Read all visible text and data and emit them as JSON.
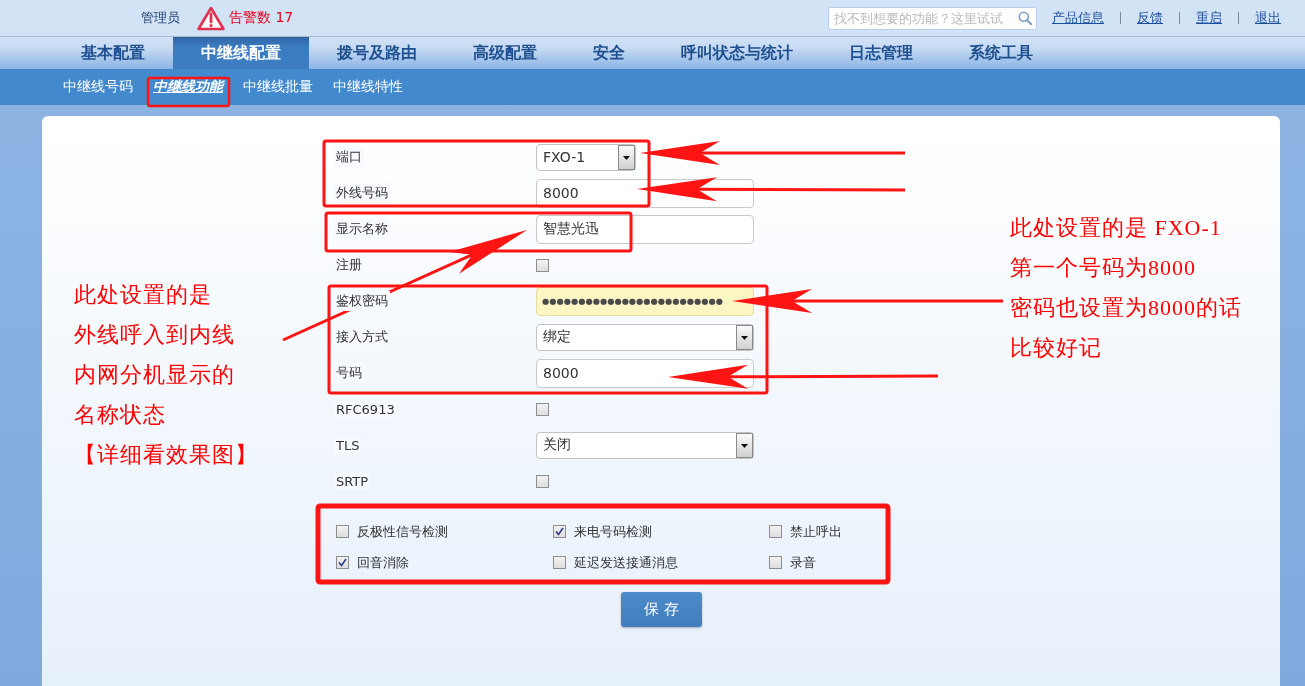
{
  "top_bar": {
    "user": "管理员",
    "alarm": "告警数 17",
    "search": {
      "placeholder": "找不到想要的功能？这里试试"
    },
    "links": [
      "产品信息",
      "反馈",
      "重启",
      "退出"
    ]
  },
  "main_nav": [
    {
      "label": "基本配置",
      "selected": false
    },
    {
      "label": "中继线配置",
      "selected": true
    },
    {
      "label": "拨号及路由",
      "selected": false
    },
    {
      "label": "高级配置",
      "selected": false
    },
    {
      "label": "安全",
      "selected": false
    },
    {
      "label": "呼叫状态与统计",
      "selected": false
    },
    {
      "label": "日志管理",
      "selected": false
    },
    {
      "label": "系统工具",
      "selected": false
    }
  ],
  "sub_nav": [
    {
      "label": "中继线号码",
      "selected": false
    },
    {
      "label": "中继线功能",
      "selected": true
    },
    {
      "label": "中继线批量",
      "selected": false
    },
    {
      "label": "中继线特性",
      "selected": false
    }
  ],
  "form": {
    "fields": [
      {
        "label": "端口",
        "kind": "select",
        "value": "FXO-1"
      },
      {
        "label": "外线号码",
        "kind": "text",
        "value": "8000"
      },
      {
        "label": "显示名称",
        "kind": "text",
        "value": "智慧光迅"
      },
      {
        "label": "注册",
        "kind": "checkbox",
        "checked": false
      },
      {
        "label": "鉴权密码",
        "kind": "password",
        "value": "●●●●●●●●●●●●●●●●●●●●●●●●●",
        "autofilled": true
      },
      {
        "label": "接入方式",
        "kind": "select",
        "value": "绑定"
      },
      {
        "label": "号码",
        "kind": "text",
        "value": "8000"
      },
      {
        "label": "RFC6913",
        "kind": "checkbox",
        "checked": false
      },
      {
        "label": "TLS",
        "kind": "select",
        "value": "关闭"
      },
      {
        "label": "SRTP",
        "kind": "checkbox",
        "checked": false
      }
    ],
    "options": [
      {
        "label": "反极性信号检测",
        "checked": false
      },
      {
        "label": "来电号码检测",
        "checked": true
      },
      {
        "label": "禁止呼出",
        "checked": false
      },
      {
        "label": "回音消除",
        "checked": true
      },
      {
        "label": "延迟发送接通消息",
        "checked": false
      },
      {
        "label": "录音",
        "checked": false
      }
    ],
    "save_button": "保 存"
  },
  "annotations": {
    "left_note": [
      "此处设置的是",
      "外线呼入到内线",
      "内网分机显示的",
      "名称状态",
      "【详细看效果图】"
    ],
    "right_note": [
      "此处设置的是 FXO-1",
      "第一个号码为8000",
      "密码也设置为8000的话",
      "比较好记"
    ]
  }
}
